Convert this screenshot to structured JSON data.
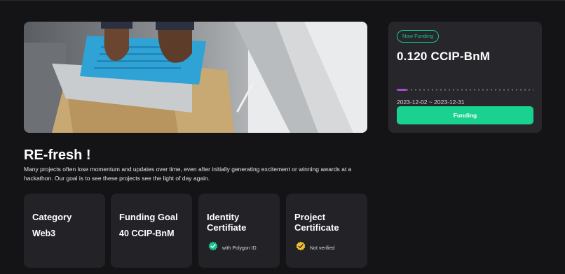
{
  "hero": {
    "image": "person-typing-on-laptop"
  },
  "funding": {
    "status_badge": "Now Funding",
    "amount": "0.120 CCIP-BnM",
    "progress_fraction": 0.003,
    "dates": "2023-12-02 ~ 2023-12-31",
    "button_label": "Funding",
    "accent_color": "#19d28f",
    "progress_color": "#a64bd6"
  },
  "project": {
    "title": "RE-fresh !",
    "description": "Many projects often lose momentum and updates over time, even after initially generating excitement or winning awards at a hackathon. Our goal is to see these projects see the light of day again."
  },
  "cards": {
    "category": {
      "label": "Category",
      "value": "Web3"
    },
    "funding_goal": {
      "label": "Funding Goal",
      "value": "40 CCIP-BnM"
    },
    "identity": {
      "label": "Identity Certifiate",
      "status": "with Polygon ID",
      "icon": "green-check-icon"
    },
    "project_cert": {
      "label": "Project Certificate",
      "status": "Not verified",
      "icon": "yellow-check-icon"
    }
  }
}
